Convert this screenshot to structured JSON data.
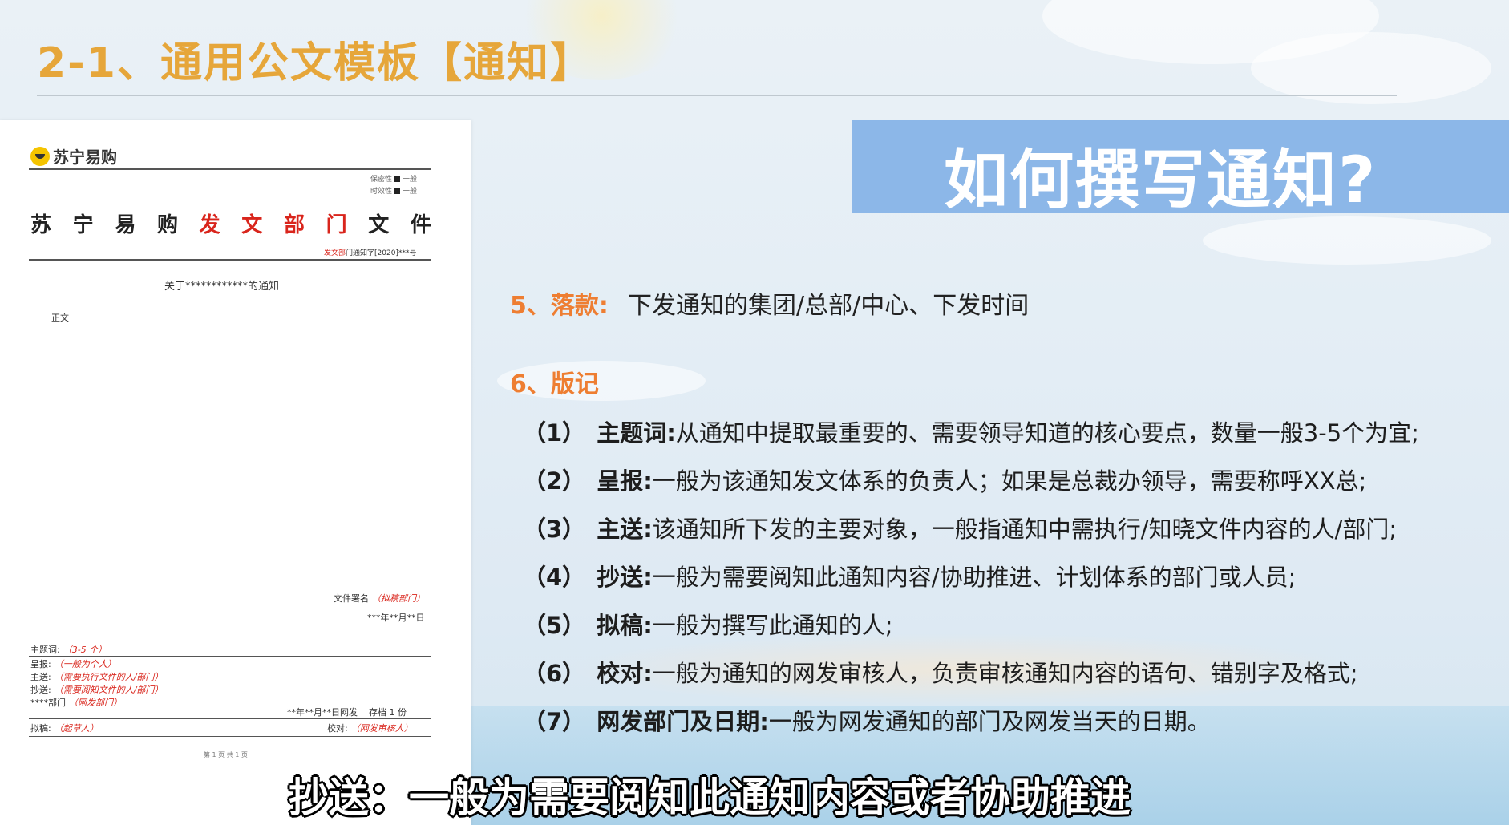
{
  "slide_title": "2-1、通用公文模板【通知】",
  "banner": "如何撰写通知?",
  "doc": {
    "logo_text": "苏宁易购",
    "meta1": "保密性",
    "meta1_val": "一般",
    "meta2": "时效性",
    "meta2_val": "一般",
    "header_chars": [
      "苏",
      "宁",
      "易",
      "购",
      "发",
      "文",
      "部",
      "门",
      "文",
      "件"
    ],
    "header_red_idx": [
      4,
      5,
      6,
      7
    ],
    "doc_no_red": "发文部",
    "doc_no_rest": "门通知字[2020]***号",
    "subject": "关于************的通知",
    "body": "正文",
    "sign_label": "文件署名",
    "sign_val": "（拟稿部门）",
    "date": "***年**月**日",
    "meta_rows": [
      {
        "label": "主题词:",
        "value": "（3-5 个）"
      },
      {
        "label": "呈报:",
        "value": "（一般为个人）"
      },
      {
        "label": "主送:",
        "value": "（需要执行文件的人/部门）"
      },
      {
        "label": "抄送:",
        "value": "（需要阅知文件的人/部门）"
      },
      {
        "label": "****部门",
        "value": "（网发部门）"
      }
    ],
    "issue_line": "**年**月**日网发",
    "archive": "存档 1 份",
    "draft_label": "拟稿:",
    "draft_val": "（起草人）",
    "proof_label": "校对:",
    "proof_val": "（网发审核人）",
    "page_footer": "第 1 页 共 1 页"
  },
  "sections": {
    "s5_heading": "5、落款:",
    "s5_body": "下发通知的集团/总部/中心、下发时间",
    "s6_heading": "6、版记"
  },
  "items": [
    {
      "num": "（1）",
      "label": "主题词:",
      "text": "从通知中提取最重要的、需要领导知道的核心要点，数量一般3-5个为宜;"
    },
    {
      "num": "（2）",
      "label": "呈报:",
      "text": "一般为该通知发文体系的负责人；如果是总裁办领导，需要称呼XX总;"
    },
    {
      "num": "（3）",
      "label": "主送:",
      "text": "该通知所下发的主要对象，一般指通知中需执行/知晓文件内容的人/部门;"
    },
    {
      "num": "（4）",
      "label": "抄送:",
      "text": "一般为需要阅知此通知内容/协助推进、计划体系的部门或人员;"
    },
    {
      "num": "（5）",
      "label": "拟稿:",
      "text": "一般为撰写此通知的人;"
    },
    {
      "num": "（6）",
      "label": "校对:",
      "text": "一般为通知的网发审核人，负责审核通知内容的语句、错别字及格式;"
    },
    {
      "num": "（7）",
      "label": "网发部门及日期:",
      "text": "一般为网发通知的部门及网发当天的日期。"
    }
  ],
  "subtitle": "抄送：一般为需要阅知此通知内容或者协助推进",
  "colors": {
    "title": "#e6a63a",
    "banner_bg": "#8cb7e8",
    "section": "#ee7e32",
    "doc_red": "#d9251c"
  }
}
